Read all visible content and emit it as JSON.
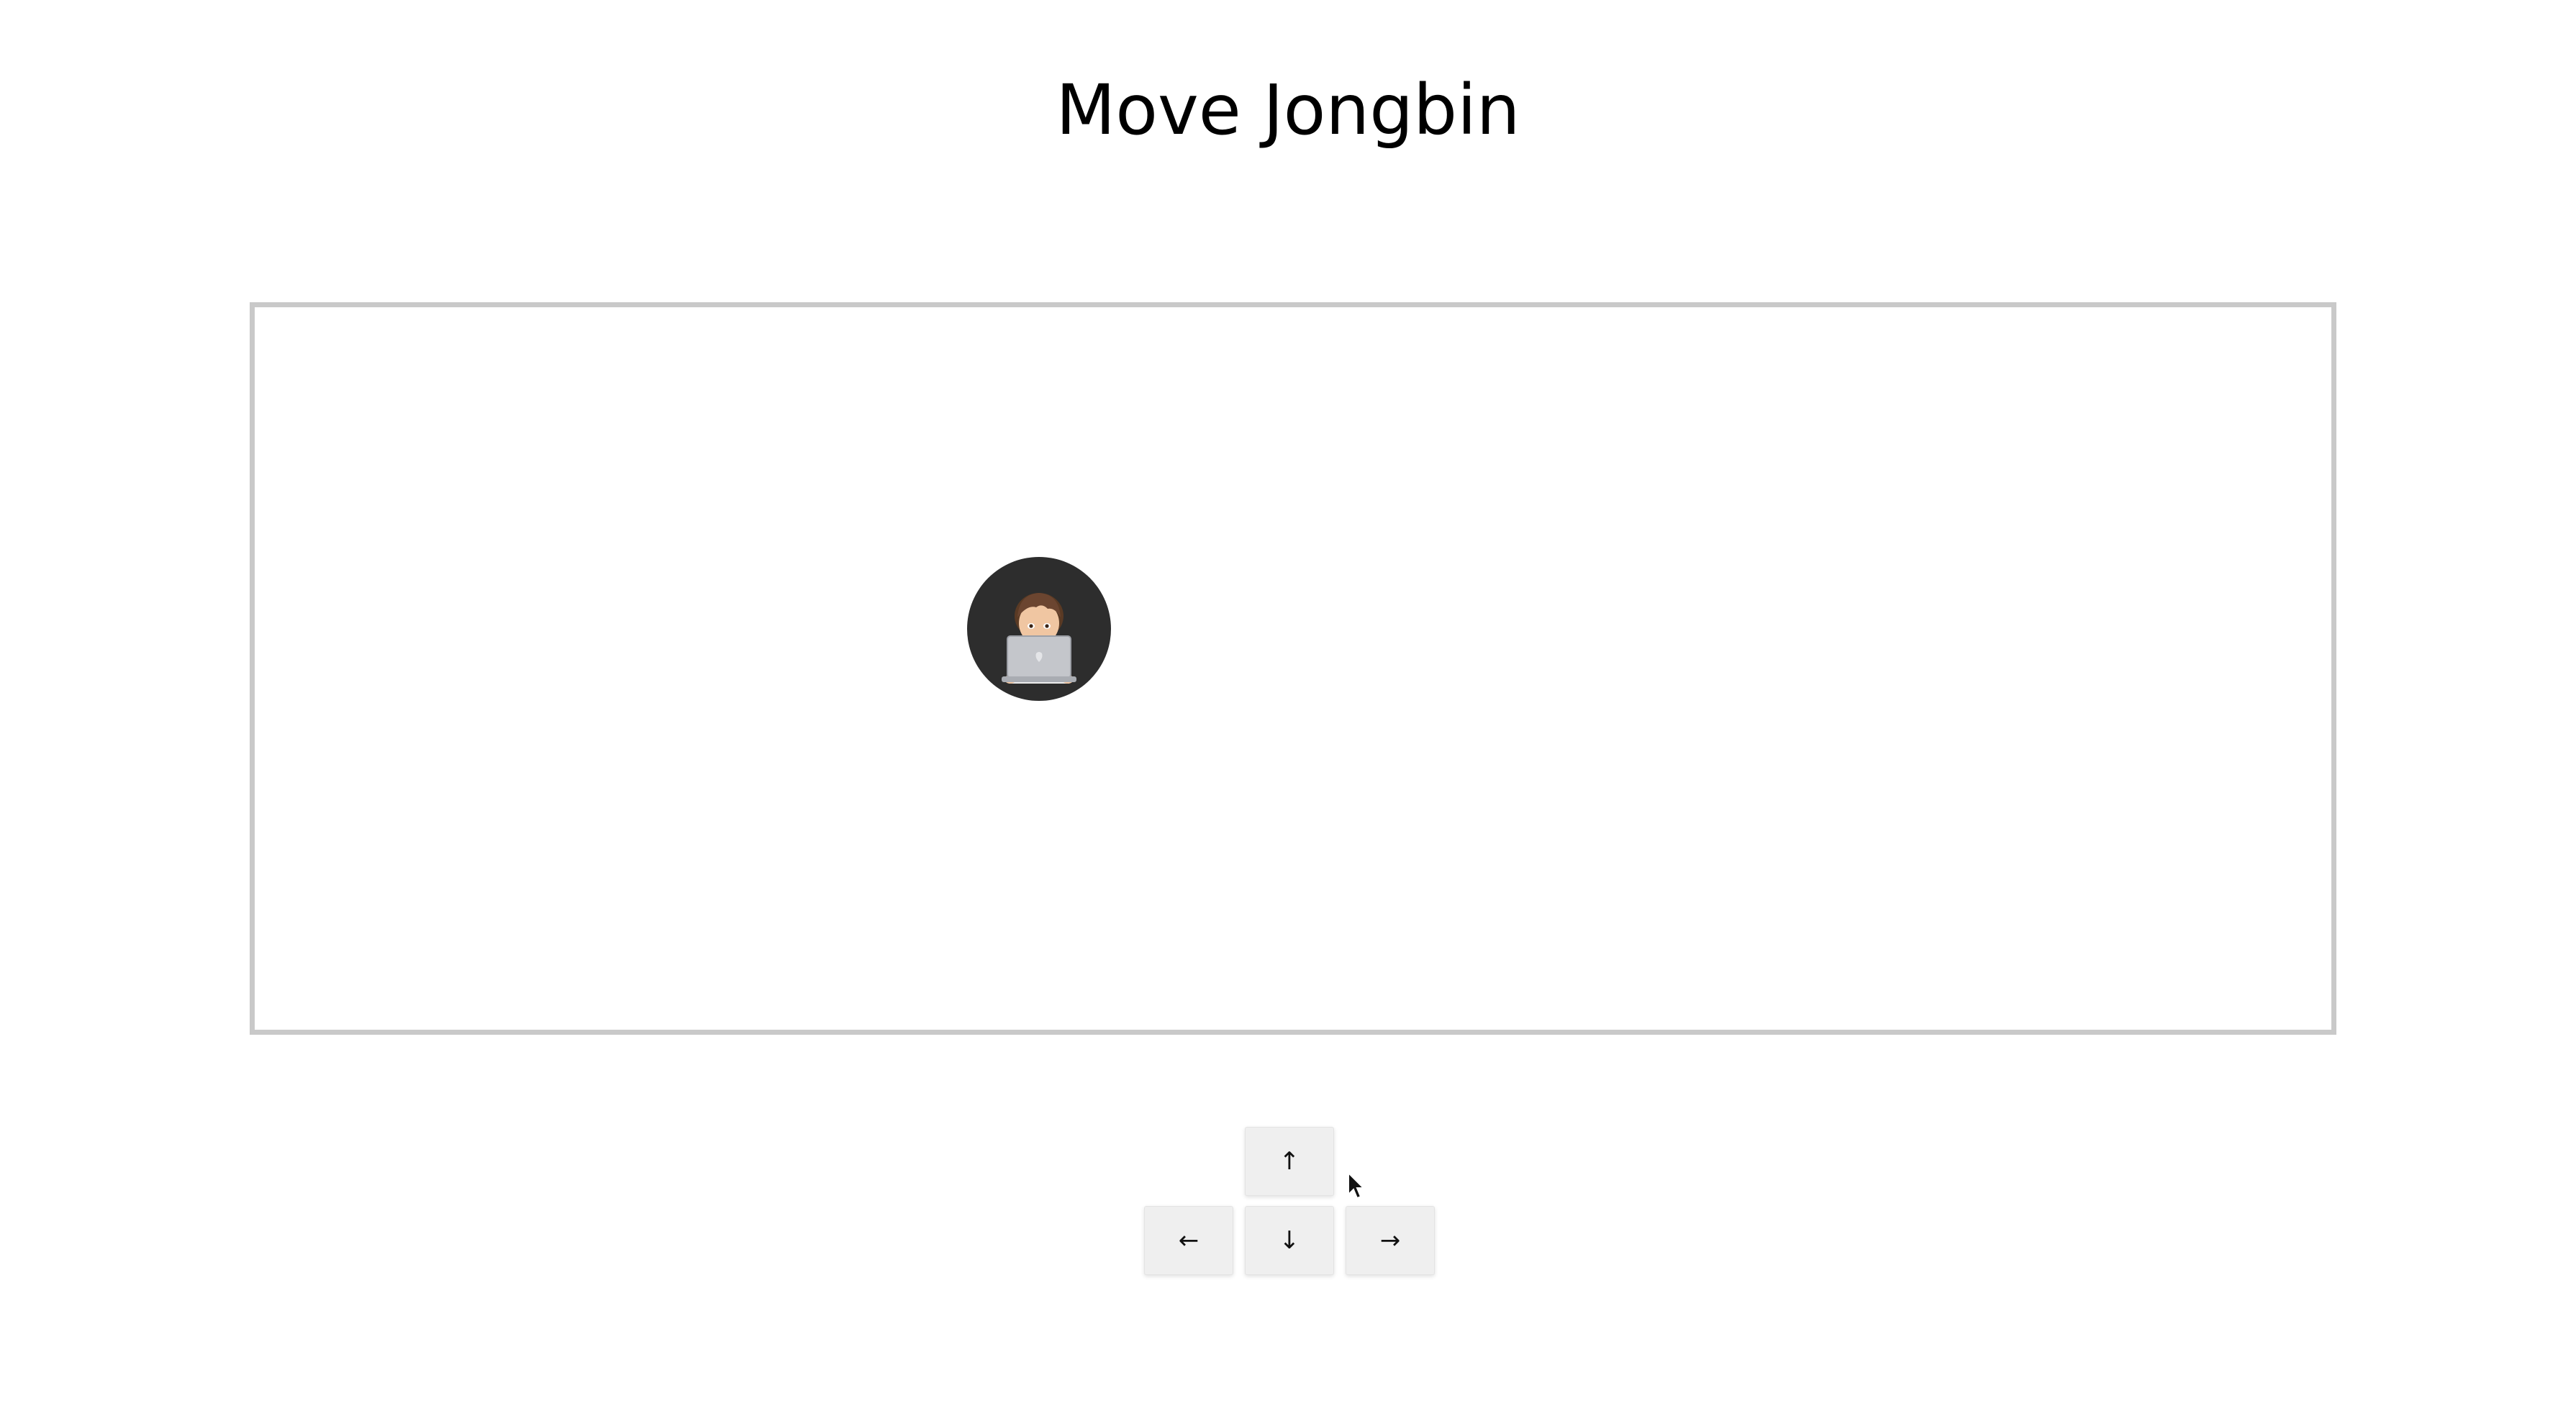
{
  "title": "Move Jongbin",
  "arena": {
    "avatar": {
      "icon": "person-with-laptop-icon",
      "background_color": "#2d2d2d"
    }
  },
  "controls": {
    "up_label": "↑",
    "left_label": "←",
    "down_label": "↓",
    "right_label": "→"
  },
  "colors": {
    "arena_border": "#c9c9c9",
    "button_bg": "#efefef"
  }
}
